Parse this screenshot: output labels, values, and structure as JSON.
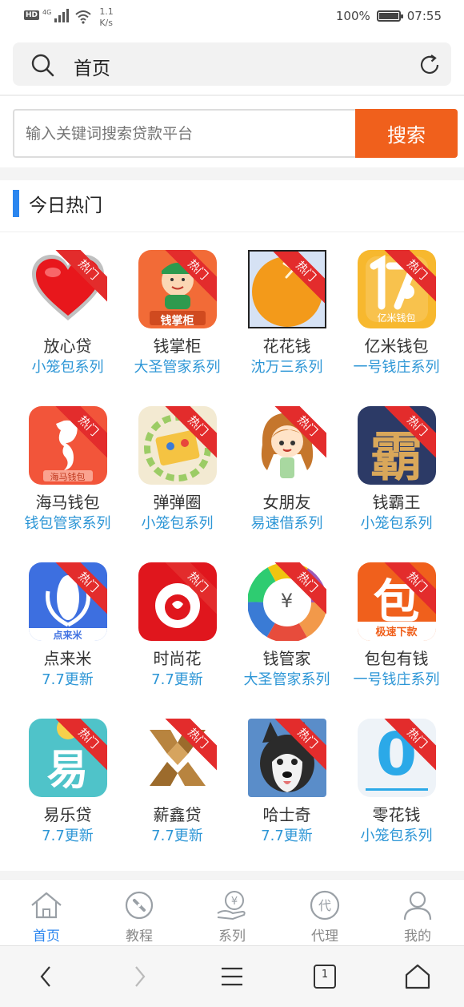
{
  "status_bar": {
    "hd": "HD",
    "network": "4G",
    "speed_value": "1.1",
    "speed_unit": "K/s",
    "battery": "100%",
    "time": "07:55"
  },
  "browser": {
    "title": "首页"
  },
  "search": {
    "placeholder": "输入关键词搜索贷款平台",
    "button_label": "搜索"
  },
  "section": {
    "title": "今日热门"
  },
  "hot_badge": "热门",
  "apps": [
    {
      "name": "放心贷",
      "series": "小笼包系列"
    },
    {
      "name": "钱掌柜",
      "series": "大圣管家系列",
      "icon_text": "钱掌柜"
    },
    {
      "name": "花花钱",
      "series": "沈万三系列"
    },
    {
      "name": "亿米钱包",
      "series": "一号钱庄系列",
      "icon_text": "亿米钱包"
    },
    {
      "name": "海马钱包",
      "series": "钱包管家系列",
      "icon_text": "海马钱包"
    },
    {
      "name": "弹弹圈",
      "series": "小笼包系列"
    },
    {
      "name": "女朋友",
      "series": "易速借系列"
    },
    {
      "name": "钱霸王",
      "series": "小笼包系列",
      "icon_text": "霸"
    },
    {
      "name": "点来米",
      "series": "7.7更新",
      "icon_text": "点来米"
    },
    {
      "name": "时尚花",
      "series": "7.7更新"
    },
    {
      "name": "钱管家",
      "series": "大圣管家系列",
      "icon_text": "¥"
    },
    {
      "name": "包包有钱",
      "series": "一号钱庄系列",
      "icon_text": "包",
      "icon_sub": "极速下款"
    },
    {
      "name": "易乐贷",
      "series": "7.7更新",
      "icon_text": "易"
    },
    {
      "name": "薪鑫贷",
      "series": "7.7更新"
    },
    {
      "name": "哈士奇",
      "series": "7.7更新"
    },
    {
      "name": "零花钱",
      "series": "小笼包系列",
      "icon_text": "0"
    }
  ],
  "tabs": [
    {
      "label": "首页",
      "icon": "home-icon"
    },
    {
      "label": "教程",
      "icon": "compass-icon"
    },
    {
      "label": "系列",
      "icon": "money-hand-icon",
      "glyph": "¥"
    },
    {
      "label": "代理",
      "icon": "agent-icon",
      "glyph": "代"
    },
    {
      "label": "我的",
      "icon": "user-icon"
    }
  ],
  "system_nav": {
    "tab_count": "1"
  },
  "colors": {
    "accent": "#f0601c",
    "blue": "#2b86ef",
    "series_text": "#2d96d6",
    "hot_ribbon": "#e32c2c"
  }
}
